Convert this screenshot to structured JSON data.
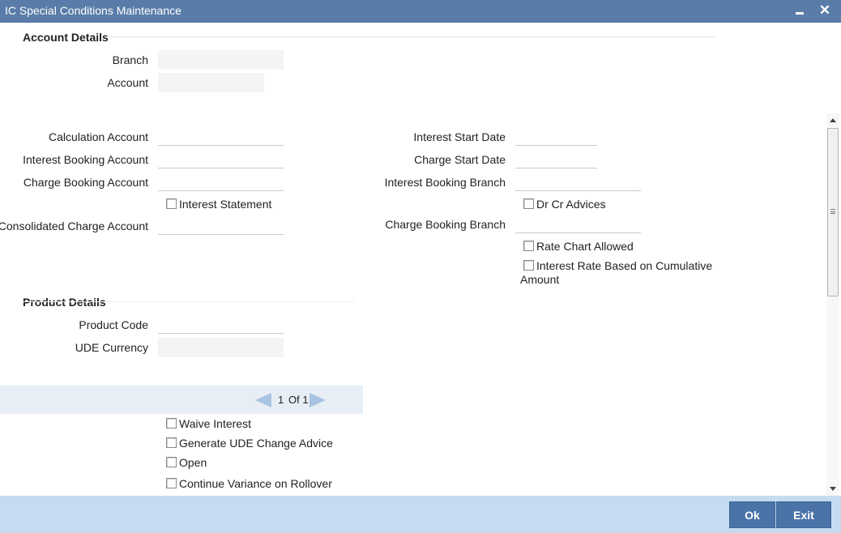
{
  "window": {
    "title": "IC Special Conditions Maintenance",
    "minimize_icon": "minimize-icon",
    "close_glyph": "✕"
  },
  "account_details": {
    "header": "Account Details",
    "branch_label": "Branch",
    "branch_value": "",
    "account_label": "Account",
    "account_value": ""
  },
  "conditions": {
    "calculation_account_label": "Calculation Account",
    "calculation_account_value": "",
    "interest_booking_account_label": "Interest Booking Account",
    "interest_booking_account_value": "",
    "charge_booking_account_label": "Charge Booking Account",
    "charge_booking_account_value": "",
    "interest_statement_label": "Interest Statement",
    "consolidated_charge_account_label": "Consolidated Charge Account",
    "consolidated_charge_account_value": "",
    "interest_start_date_label": "Interest Start Date",
    "interest_start_date_value": "",
    "charge_start_date_label": "Charge Start Date",
    "charge_start_date_value": "",
    "interest_booking_branch_label": "Interest Booking Branch",
    "interest_booking_branch_value": "",
    "dr_cr_advices_label": "Dr Cr Advices",
    "charge_booking_branch_label": "Charge Booking Branch",
    "charge_booking_branch_value": "",
    "rate_chart_allowed_label": "Rate Chart Allowed",
    "interest_rate_cumulative_label_line1": "Interest Rate Based on Cumulative",
    "interest_rate_cumulative_label_line2": "Amount"
  },
  "product_details": {
    "header": "Product Details",
    "product_code_label": "Product Code",
    "product_code_value": "",
    "ude_currency_label": "UDE Currency",
    "ude_currency_value": ""
  },
  "pager": {
    "current": "1",
    "of_total": "Of 1"
  },
  "options": {
    "waive_interest": "Waive Interest",
    "generate_ude_change_advice": "Generate UDE Change Advice",
    "open": "Open",
    "continue_variance_on_rollover": "Continue Variance on Rollover"
  },
  "footer": {
    "ok_label": "Ok",
    "exit_label": "Exit"
  },
  "colors": {
    "titlebar": "#5a7ca8",
    "footer": "#c5dbef",
    "button": "#4a73a8"
  }
}
